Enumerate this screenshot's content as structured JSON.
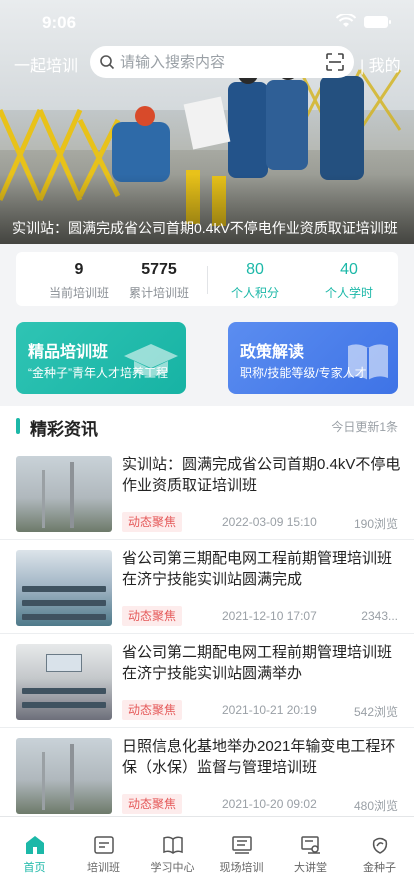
{
  "status_bar": {
    "time": "9:06"
  },
  "header": {
    "brand": "一起培训",
    "search_placeholder": "请输入搜索内容",
    "mine_label": "| 我的"
  },
  "banner": {
    "caption": "实训站：圆满完成省公司首期0.4kV不停电作业资质取证培训班"
  },
  "stats": [
    {
      "value": "9",
      "label": "当前培训班"
    },
    {
      "value": "5775",
      "label": "累计培训班"
    },
    {
      "value": "80",
      "label": "个人积分"
    },
    {
      "value": "40",
      "label": "个人学时"
    }
  ],
  "feature_cards": [
    {
      "title": "精品培训班",
      "subtitle": "“金种子”青年人才培养工程"
    },
    {
      "title": "政策解读",
      "subtitle": "职称/技能等级/专家人才"
    }
  ],
  "news": {
    "section_title": "精彩资讯",
    "update_note": "今日更新1条",
    "items": [
      {
        "title": "实训站：圆满完成省公司首期0.4kV不停电作业资质取证培训班",
        "tag": "动态聚焦",
        "date": "2022-03-09 15:10",
        "views": "190浏览"
      },
      {
        "title": "省公司第三期配电网工程前期管理培训班在济宁技能实训站圆满完成",
        "tag": "动态聚焦",
        "date": "2021-12-10 17:07",
        "views": "2343..."
      },
      {
        "title": "省公司第二期配电网工程前期管理培训班在济宁技能实训站圆满举办",
        "tag": "动态聚焦",
        "date": "2021-10-21 20:19",
        "views": "542浏览"
      },
      {
        "title": "日照信息化基地举办2021年输变电工程环保（水保）监督与管理培训班",
        "tag": "动态聚焦",
        "date": "2021-10-20 09:02",
        "views": "480浏览"
      }
    ]
  },
  "tabbar": [
    {
      "label": "首页",
      "icon": "home-icon"
    },
    {
      "label": "培训班",
      "icon": "class-icon"
    },
    {
      "label": "学习中心",
      "icon": "book-icon"
    },
    {
      "label": "现场培训",
      "icon": "onsite-icon"
    },
    {
      "label": "大讲堂",
      "icon": "lecture-icon"
    },
    {
      "label": "金种子",
      "icon": "seed-icon"
    }
  ],
  "colors": {
    "accent": "#1cb8a8",
    "tag_red": "#e55a5a",
    "card_blue": "#3e73e6"
  }
}
